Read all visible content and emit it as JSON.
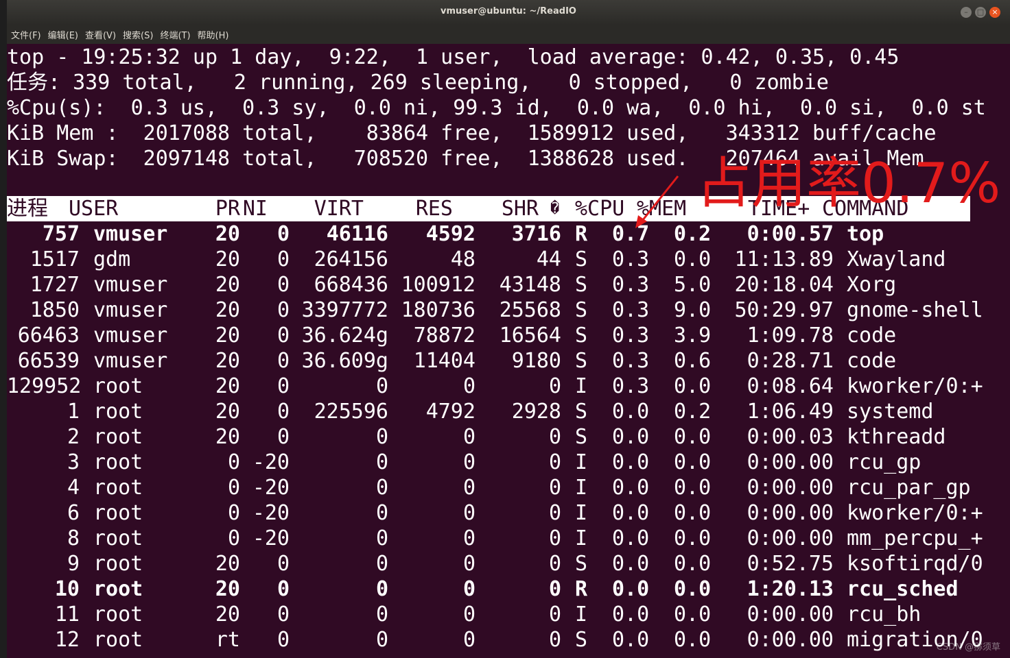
{
  "window": {
    "title": "vmuser@ubuntu: ~/ReadIO"
  },
  "menu": [
    "文件(F)",
    "编辑(E)",
    "查看(V)",
    "搜索(S)",
    "终端(T)",
    "帮助(H)"
  ],
  "summary": [
    "top - 19:25:32 up 1 day,  9:22,  1 user,  load average: 0.42, 0.35, 0.45",
    "任务: 339 total,   2 running, 269 sleeping,   0 stopped,   0 zombie",
    "%Cpu(s):  0.3 us,  0.3 sy,  0.0 ni, 99.3 id,  0.0 wa,  0.0 hi,  0.0 si,  0.0 st",
    "KiB Mem :  2017088 total,    83864 free,  1589912 used,   343312 buff/cache",
    "KiB Swap:  2097148 total,   708520 free,  1388628 used.   207464 avail Mem"
  ],
  "header": [
    "进程",
    "USER",
    "PR",
    "NI",
    "VIRT",
    "RES",
    "SHR",
    "�",
    "%CPU",
    "%MEM",
    "TIME+",
    "COMMAND"
  ],
  "processes": [
    {
      "pid": "757",
      "user": "vmuser",
      "pr": "20",
      "ni": "0",
      "virt": "46116",
      "res": "4592",
      "shr": "3716",
      "s": "R",
      "cpu": "0.7",
      "mem": "0.2",
      "time": "0:00.57",
      "cmd": "top"
    },
    {
      "pid": "1517",
      "user": "gdm",
      "pr": "20",
      "ni": "0",
      "virt": "264156",
      "res": "48",
      "shr": "44",
      "s": "S",
      "cpu": "0.3",
      "mem": "0.0",
      "time": "11:13.89",
      "cmd": "Xwayland"
    },
    {
      "pid": "1727",
      "user": "vmuser",
      "pr": "20",
      "ni": "0",
      "virt": "668436",
      "res": "100912",
      "shr": "43148",
      "s": "S",
      "cpu": "0.3",
      "mem": "5.0",
      "time": "20:18.04",
      "cmd": "Xorg"
    },
    {
      "pid": "1850",
      "user": "vmuser",
      "pr": "20",
      "ni": "0",
      "virt": "3397772",
      "res": "180736",
      "shr": "25568",
      "s": "S",
      "cpu": "0.3",
      "mem": "9.0",
      "time": "50:29.97",
      "cmd": "gnome-shell"
    },
    {
      "pid": "66463",
      "user": "vmuser",
      "pr": "20",
      "ni": "0",
      "virt": "36.624g",
      "res": "78872",
      "shr": "16564",
      "s": "S",
      "cpu": "0.3",
      "mem": "3.9",
      "time": "1:09.78",
      "cmd": "code"
    },
    {
      "pid": "66539",
      "user": "vmuser",
      "pr": "20",
      "ni": "0",
      "virt": "36.609g",
      "res": "11404",
      "shr": "9180",
      "s": "S",
      "cpu": "0.3",
      "mem": "0.6",
      "time": "0:28.71",
      "cmd": "code"
    },
    {
      "pid": "129952",
      "user": "root",
      "pr": "20",
      "ni": "0",
      "virt": "0",
      "res": "0",
      "shr": "0",
      "s": "I",
      "cpu": "0.3",
      "mem": "0.0",
      "time": "0:08.64",
      "cmd": "kworker/0:+"
    },
    {
      "pid": "1",
      "user": "root",
      "pr": "20",
      "ni": "0",
      "virt": "225596",
      "res": "4792",
      "shr": "2928",
      "s": "S",
      "cpu": "0.0",
      "mem": "0.2",
      "time": "1:06.49",
      "cmd": "systemd"
    },
    {
      "pid": "2",
      "user": "root",
      "pr": "20",
      "ni": "0",
      "virt": "0",
      "res": "0",
      "shr": "0",
      "s": "S",
      "cpu": "0.0",
      "mem": "0.0",
      "time": "0:00.03",
      "cmd": "kthreadd"
    },
    {
      "pid": "3",
      "user": "root",
      "pr": "0",
      "ni": "-20",
      "virt": "0",
      "res": "0",
      "shr": "0",
      "s": "I",
      "cpu": "0.0",
      "mem": "0.0",
      "time": "0:00.00",
      "cmd": "rcu_gp"
    },
    {
      "pid": "4",
      "user": "root",
      "pr": "0",
      "ni": "-20",
      "virt": "0",
      "res": "0",
      "shr": "0",
      "s": "I",
      "cpu": "0.0",
      "mem": "0.0",
      "time": "0:00.00",
      "cmd": "rcu_par_gp"
    },
    {
      "pid": "6",
      "user": "root",
      "pr": "0",
      "ni": "-20",
      "virt": "0",
      "res": "0",
      "shr": "0",
      "s": "I",
      "cpu": "0.0",
      "mem": "0.0",
      "time": "0:00.00",
      "cmd": "kworker/0:+"
    },
    {
      "pid": "8",
      "user": "root",
      "pr": "0",
      "ni": "-20",
      "virt": "0",
      "res": "0",
      "shr": "0",
      "s": "I",
      "cpu": "0.0",
      "mem": "0.0",
      "time": "0:00.00",
      "cmd": "mm_percpu_+"
    },
    {
      "pid": "9",
      "user": "root",
      "pr": "20",
      "ni": "0",
      "virt": "0",
      "res": "0",
      "shr": "0",
      "s": "S",
      "cpu": "0.0",
      "mem": "0.0",
      "time": "0:52.75",
      "cmd": "ksoftirqd/0"
    },
    {
      "pid": "10",
      "user": "root",
      "pr": "20",
      "ni": "0",
      "virt": "0",
      "res": "0",
      "shr": "0",
      "s": "R",
      "cpu": "0.0",
      "mem": "0.0",
      "time": "1:20.13",
      "cmd": "rcu_sched"
    },
    {
      "pid": "11",
      "user": "root",
      "pr": "20",
      "ni": "0",
      "virt": "0",
      "res": "0",
      "shr": "0",
      "s": "I",
      "cpu": "0.0",
      "mem": "0.0",
      "time": "0:00.00",
      "cmd": "rcu_bh"
    },
    {
      "pid": "12",
      "user": "root",
      "pr": "rt",
      "ni": "0",
      "virt": "0",
      "res": "0",
      "shr": "0",
      "s": "S",
      "cpu": "0.0",
      "mem": "0.0",
      "time": "0:00.00",
      "cmd": "migration/0"
    }
  ],
  "annotation": "占用率0.7%",
  "watermark": "CSDN @猕须草",
  "colors": {
    "terminal_bg": "#300a24",
    "annotation": "#e21b1b"
  }
}
